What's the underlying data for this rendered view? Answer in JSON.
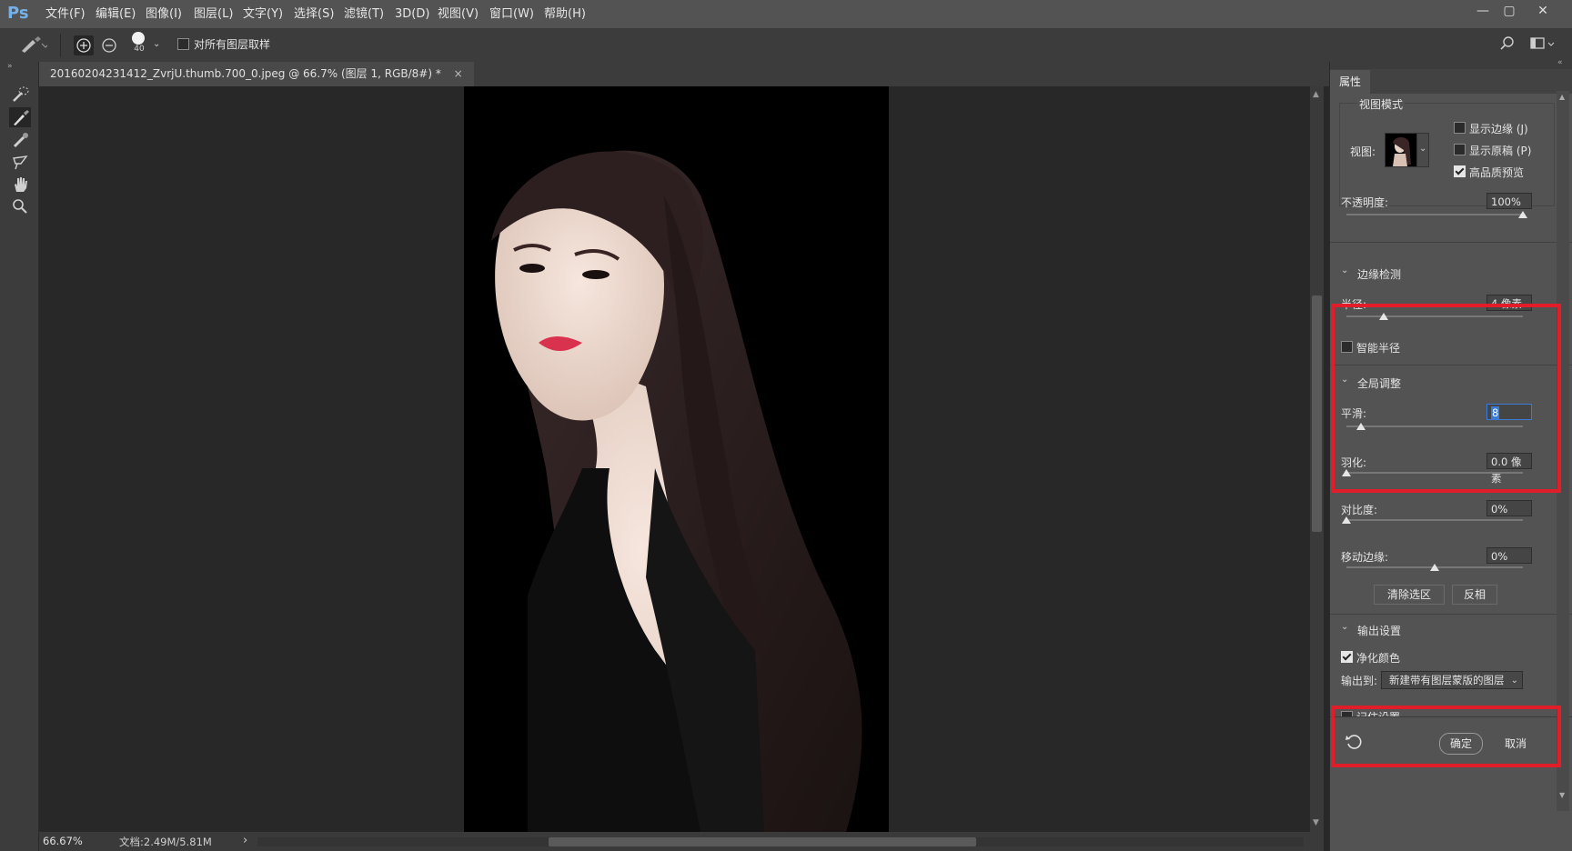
{
  "app": {
    "logo": "Ps"
  },
  "menu": [
    "文件(F)",
    "编辑(E)",
    "图像(I)",
    "图层(L)",
    "文字(Y)",
    "选择(S)",
    "滤镜(T)",
    "3D(D)",
    "视图(V)",
    "窗口(W)",
    "帮助(H)"
  ],
  "window_controls": {
    "minimize": "—",
    "restore": "▢",
    "close": "✕"
  },
  "options_bar": {
    "brush_size": "40",
    "sample_all_label": "对所有图层取样",
    "sample_all_checked": false
  },
  "document": {
    "tab_title": "20160204231412_ZvrjU.thumb.700_0.jpeg @ 66.7% (图层 1, RGB/8#) *",
    "close": "×"
  },
  "status": {
    "zoom": "66.67%",
    "doc_info": "文档:2.49M/5.81M",
    "arrow": "›"
  },
  "panel": {
    "tab": "属性",
    "view_mode": {
      "title": "视图模式",
      "view_label": "视图:",
      "show_edge": "显示边缘 (J)",
      "show_original": "显示原稿 (P)",
      "high_quality": "高品质预览",
      "show_edge_checked": false,
      "show_original_checked": false,
      "high_quality_checked": true
    },
    "opacity": {
      "label": "不透明度:",
      "value": "100%",
      "level": 1.0
    },
    "edge_detection": {
      "title": "边缘检测",
      "radius_label": "半径:",
      "radius_value": "4 像素",
      "radius_level": 0.21,
      "smart_radius": "智能半径",
      "smart_radius_checked": false
    },
    "global_refine": {
      "title": "全局调整",
      "smooth_label": "平滑:",
      "smooth_value": "8",
      "smooth_level": 0.08,
      "feather_label": "羽化:",
      "feather_value": "0.0 像素",
      "feather_level": 0.0,
      "contrast_label": "对比度:",
      "contrast_value": "0%",
      "contrast_level": 0.0,
      "shift_label": "移动边缘:",
      "shift_value": "0%",
      "shift_level": 0.5,
      "clear_button": "清除选区",
      "invert_button": "反相"
    },
    "output": {
      "title": "输出设置",
      "decontaminate": "净化颜色",
      "decontaminate_checked": true,
      "output_to_label": "输出到:",
      "output_to_value": "新建带有图层蒙版的图层",
      "remember": "记住设置"
    },
    "ok": "确定",
    "cancel": "取消"
  },
  "colors": {
    "highlight": "#e11d2a",
    "menu_bg": "#535353",
    "panel_bg": "#535353",
    "canvas_bg": "#282828"
  }
}
